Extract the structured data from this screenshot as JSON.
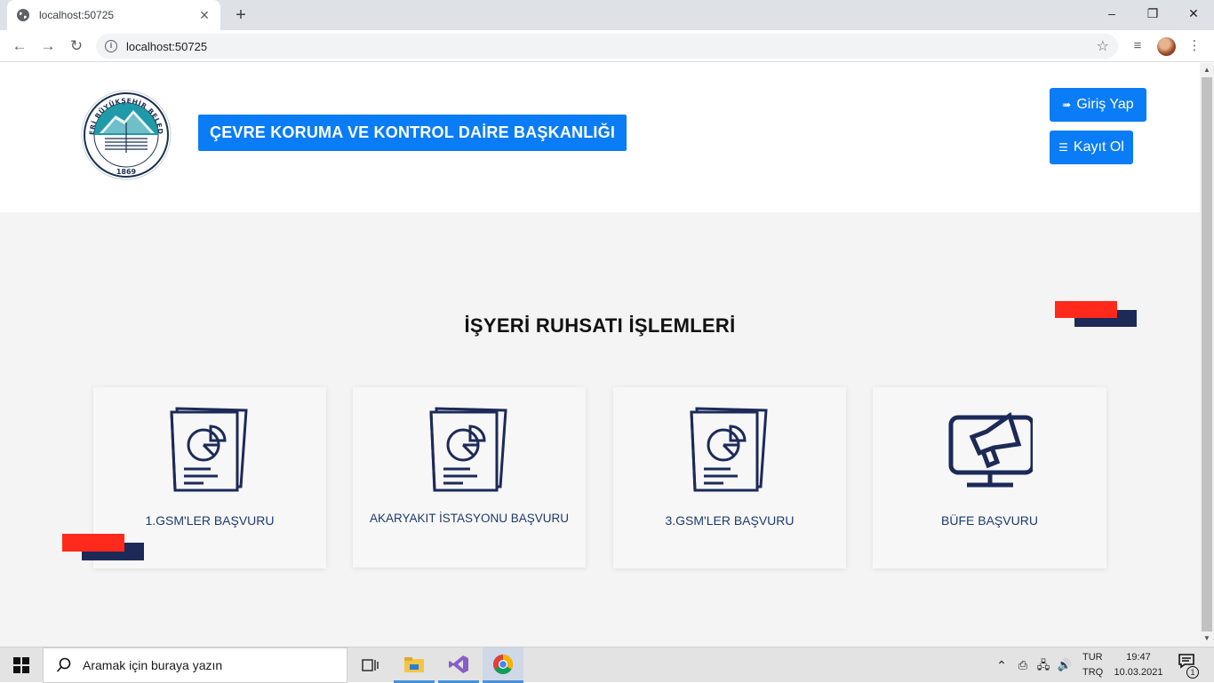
{
  "browser": {
    "tab_title": "localhost:50725",
    "tab_close": "✕",
    "new_tab": "+",
    "url": "localhost:50725",
    "window_controls": {
      "minimize": "–",
      "maximize": "❐",
      "close": "✕"
    }
  },
  "header": {
    "department_title": "ÇEVRE KORUMA VE KONTROL DAİRE BAŞKANLIĞI",
    "logo_text_top": "KAYSERİ BÜYÜKŞEHİR BELEDİYESİ",
    "logo_year": "1869",
    "login_button": "Giriş Yap",
    "register_button": "Kayıt Ol"
  },
  "main": {
    "section_title": "İŞYERİ RUHSATI İŞLEMLERİ",
    "cards": [
      {
        "label": "1.GSM'LER BAŞVURU",
        "icon": "documents-chart-icon"
      },
      {
        "label": "AKARYAKIT İSTASYONU BAŞVURU",
        "icon": "documents-chart-icon"
      },
      {
        "label": "3.GSM'LER BAŞVURU",
        "icon": "documents-chart-icon"
      },
      {
        "label": "BÜFE BAŞVURU",
        "icon": "monitor-megaphone-icon"
      }
    ]
  },
  "colors": {
    "primary": "#0a7cf6",
    "accent_red": "#ff2a1c",
    "accent_navy": "#1c2a58",
    "card_text": "#1e3a6e"
  },
  "taskbar": {
    "search_placeholder": "Aramak için buraya yazın",
    "lang_top": "TUR",
    "lang_bottom": "TRQ",
    "time": "19:47",
    "date": "10.03.2021",
    "notification_count": "1"
  }
}
